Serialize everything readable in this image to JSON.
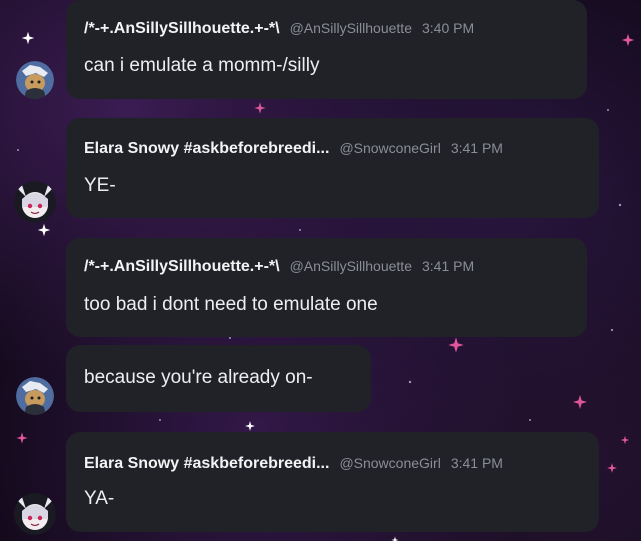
{
  "messages": [
    {
      "username": "/*-+.AnSillySillhouette.+-*\\",
      "handle": "@AnSillySillhouette",
      "time": "3:40 PM",
      "text": "can i emulate a momm-/silly"
    },
    {
      "username": "Elara Snowy #askbeforebreedi...",
      "handle": "@SnowconeGirl",
      "time": "3:41 PM",
      "text": "YE-"
    },
    {
      "username": "/*-+.AnSillySillhouette.+-*\\",
      "handle": "@AnSillySillhouette",
      "time": "3:41 PM",
      "text": "too bad i dont need to emulate one"
    },
    {
      "text": "because you're already on-"
    },
    {
      "username": "Elara Snowy #askbeforebreedi...",
      "handle": "@SnowconeGirl",
      "time": "3:41 PM",
      "text": "YA-"
    }
  ],
  "colors": {
    "bubble": "#202227",
    "text": "#eceef1",
    "meta": "#8b8e96",
    "star_pink": "#e0569a",
    "star_white": "#ffffff"
  },
  "icons": [
    "sparkle-star-icon"
  ]
}
